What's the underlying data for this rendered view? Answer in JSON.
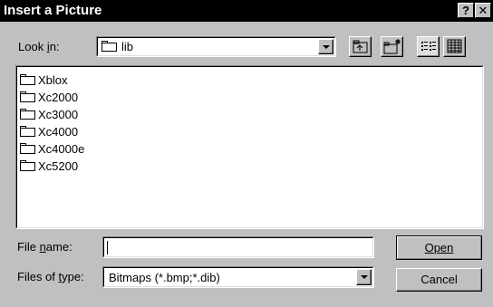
{
  "window": {
    "title": "Insert a Picture",
    "help_label": "?",
    "close_label": "✕"
  },
  "look_in": {
    "label": "Look in:",
    "value": "lib"
  },
  "files": [
    {
      "name": "Xblox",
      "icon": "folder-icon"
    },
    {
      "name": "Xc2000",
      "icon": "folder-icon"
    },
    {
      "name": "Xc3000",
      "icon": "folder-icon"
    },
    {
      "name": "Xc4000",
      "icon": "folder-icon"
    },
    {
      "name": "Xc4000e",
      "icon": "folder-icon"
    },
    {
      "name": "Xc5200",
      "icon": "folder-icon"
    }
  ],
  "file_name": {
    "label": "File name:",
    "value": ""
  },
  "file_type": {
    "label": "Files of type:",
    "value": "Bitmaps (*.bmp;*.dib)"
  },
  "buttons": {
    "open": "Open",
    "cancel": "Cancel"
  }
}
